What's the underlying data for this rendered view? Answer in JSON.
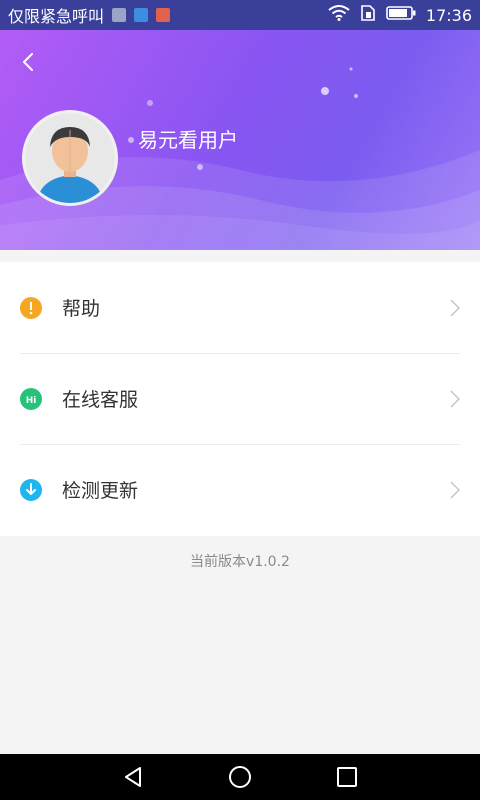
{
  "status_bar": {
    "carrier_text": "仅限紧急呼叫",
    "time": "17:36",
    "notif_colors": [
      "#9aa3c8",
      "#3c8fe0",
      "#e0624e"
    ]
  },
  "header": {
    "username": "易元看用户",
    "gradient_colors": [
      "#b35cf6",
      "#8a55f2",
      "#9a78f7"
    ]
  },
  "menu": {
    "items": [
      {
        "label": "帮助",
        "icon": "info-icon",
        "icon_color": "#f5a623"
      },
      {
        "label": "在线客服",
        "icon": "chat-hi-icon",
        "icon_color": "#27c27a"
      },
      {
        "label": "检测更新",
        "icon": "download-icon",
        "icon_color": "#1fb6f0"
      }
    ]
  },
  "version_text": "当前版本v1.0.2"
}
